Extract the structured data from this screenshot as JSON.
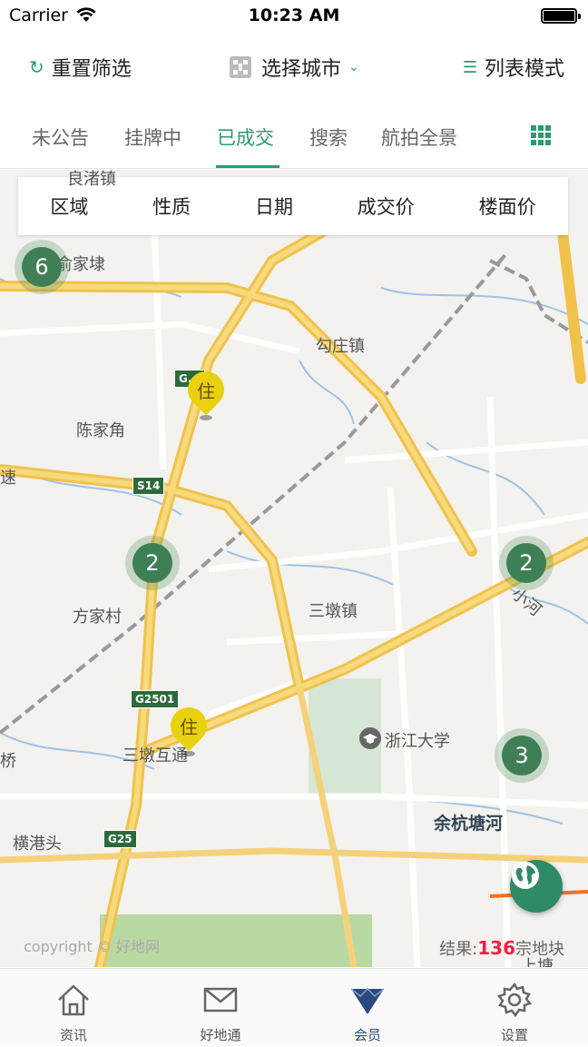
{
  "status_bar": {
    "carrier": "Carrier",
    "time": "10:23 AM"
  },
  "toolbar": {
    "reset_label": "重置筛选",
    "city_label": "选择城市",
    "list_mode_label": "列表模式"
  },
  "tabs": [
    {
      "label": "未公告",
      "active": false
    },
    {
      "label": "挂牌中",
      "active": false
    },
    {
      "label": "已成交",
      "active": true
    },
    {
      "label": "搜索",
      "active": false
    },
    {
      "label": "航拍全景",
      "active": false
    }
  ],
  "filters": [
    "区域",
    "性质",
    "日期",
    "成交价",
    "楼面价"
  ],
  "map": {
    "clusters": [
      {
        "count": "6"
      },
      {
        "count": "2"
      },
      {
        "count": "2"
      },
      {
        "count": "3"
      }
    ],
    "pins": [
      {
        "label": "住"
      },
      {
        "label": "住"
      }
    ],
    "place_labels": [
      "俞家埭",
      "勾庄镇",
      "陈家角",
      "速",
      "方家村",
      "三墩镇",
      "小河",
      "浙江大学",
      "三墩互通",
      "桥",
      "横港头",
      "余杭塘河",
      "上塘",
      "良渚镇"
    ],
    "road_shields": [
      "G...",
      "S14",
      "G2501",
      "G25"
    ],
    "copyright": "copyright © 好地网",
    "result_prefix": "结果:",
    "result_count": "136",
    "result_suffix": "宗地块"
  },
  "tabbar": [
    {
      "label": "资讯",
      "icon": "home-icon",
      "active": false
    },
    {
      "label": "好地通",
      "icon": "mail-icon",
      "active": false
    },
    {
      "label": "会员",
      "icon": "diamond-icon",
      "active": true
    },
    {
      "label": "设置",
      "icon": "gear-icon",
      "active": false
    }
  ],
  "colors": {
    "accent": "#2a9d6e",
    "active_member": "#2c4a7d",
    "result_count": "#e22244"
  }
}
